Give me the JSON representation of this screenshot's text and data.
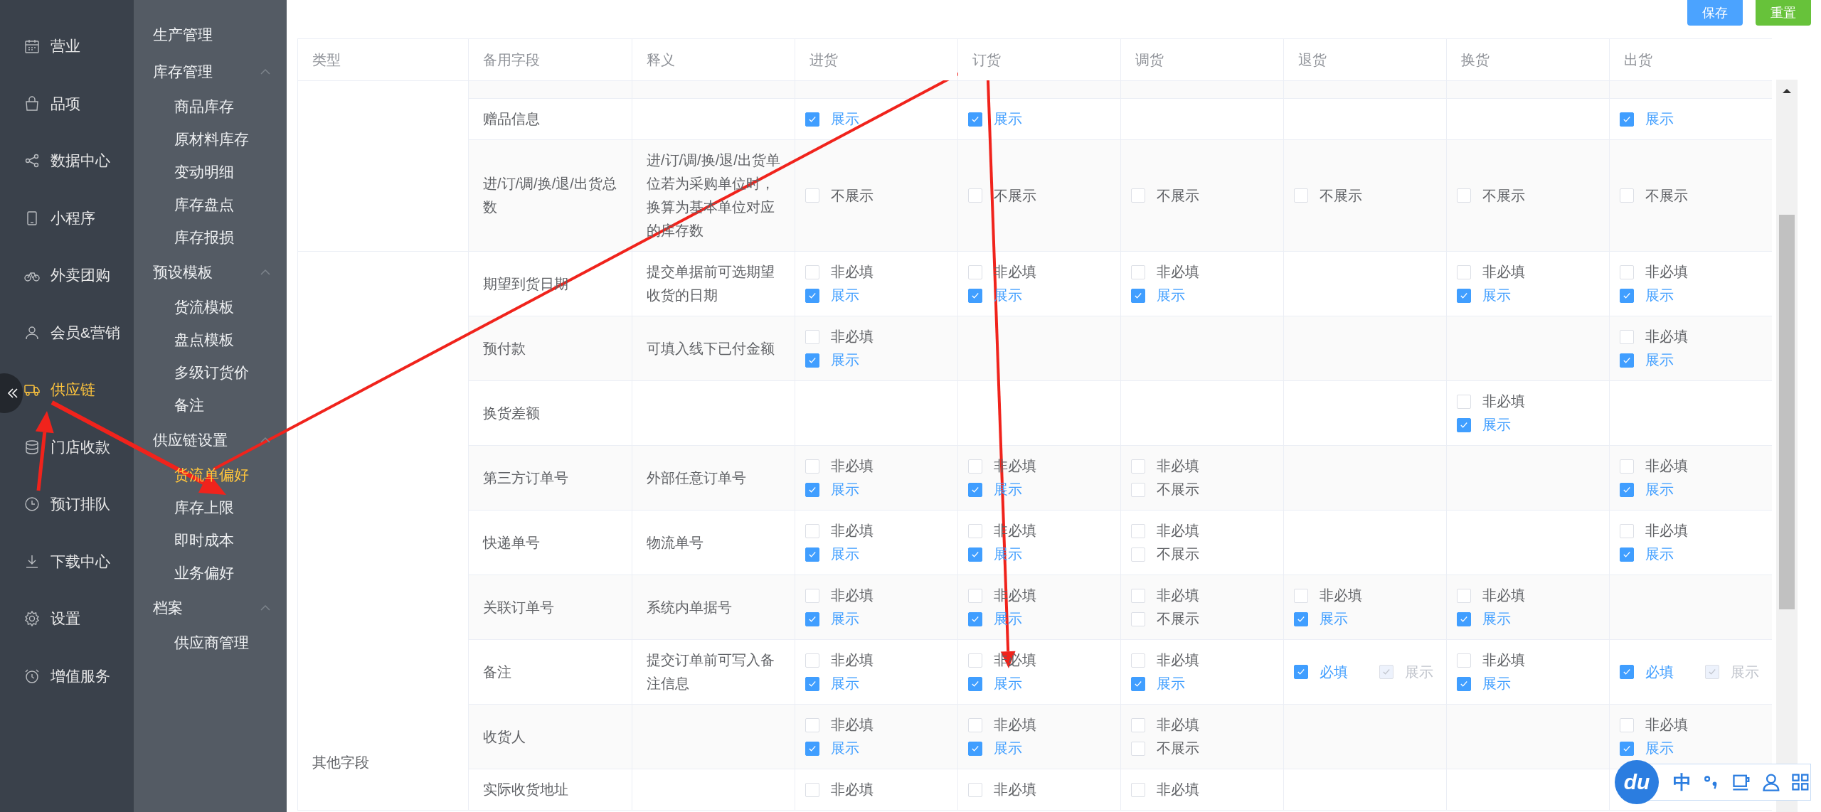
{
  "nav": [
    {
      "label": "营业",
      "selected": false
    },
    {
      "label": "品项",
      "selected": false
    },
    {
      "label": "数据中心",
      "selected": false
    },
    {
      "label": "小程序",
      "selected": false
    },
    {
      "label": "外卖团购",
      "selected": false
    },
    {
      "label": "会员&营销",
      "selected": false
    },
    {
      "label": "供应链",
      "selected": true
    },
    {
      "label": "门店收款",
      "selected": false
    },
    {
      "label": "预订排队",
      "selected": false
    },
    {
      "label": "下载中心",
      "selected": false
    },
    {
      "label": "设置",
      "selected": false
    },
    {
      "label": "增值服务",
      "selected": false
    }
  ],
  "subnav": [
    {
      "kind": "single",
      "label": "生产管理"
    },
    {
      "kind": "group",
      "label": "库存管理",
      "expanded": true,
      "children": [
        {
          "label": "商品库存",
          "selected": false
        },
        {
          "label": "原材料库存",
          "selected": false
        },
        {
          "label": "变动明细",
          "selected": false
        },
        {
          "label": "库存盘点",
          "selected": false
        },
        {
          "label": "库存报损",
          "selected": false
        }
      ]
    },
    {
      "kind": "group",
      "label": "预设模板",
      "expanded": true,
      "children": [
        {
          "label": "货流模板",
          "selected": false
        },
        {
          "label": "盘点模板",
          "selected": false
        },
        {
          "label": "多级订货价",
          "selected": false
        },
        {
          "label": "备注",
          "selected": false
        }
      ]
    },
    {
      "kind": "group",
      "label": "供应链设置",
      "expanded": true,
      "children": [
        {
          "label": "货流单偏好",
          "selected": true
        },
        {
          "label": "库存上限",
          "selected": false
        },
        {
          "label": "即时成本",
          "selected": false
        },
        {
          "label": "业务偏好",
          "selected": false
        }
      ]
    },
    {
      "kind": "group",
      "label": "档案",
      "expanded": true,
      "children": [
        {
          "label": "供应商管理",
          "selected": false
        }
      ]
    }
  ],
  "buttons": [
    {
      "label": "保存",
      "kind": "primary"
    },
    {
      "label": "重置",
      "kind": "success"
    }
  ],
  "table": {
    "columns": [
      "类型",
      "备用字段",
      "释义",
      "进货",
      "订货",
      "调货",
      "退货",
      "换货",
      "出货"
    ],
    "groups": [
      {
        "rows": [
          {
            "field": "赠品信息",
            "cells": [
              {
                "kind": "stack",
                "options": [
                  {
                    "label": "展示",
                    "checked": true,
                    "disabled": false
                  }
                ]
              },
              {
                "kind": "stack",
                "options": [
                  {
                    "label": "展示",
                    "checked": true,
                    "disabled": false
                  }
                ]
              },
              null,
              null,
              null,
              {
                "kind": "stack",
                "options": [
                  {
                    "label": "展示",
                    "checked": true,
                    "disabled": false
                  }
                ]
              }
            ]
          },
          {
            "field": "进/订/调/换/退/出货总数",
            "note": "进/订/调/换/退/出货单位若为采购单位时，换算为基本单位对应的库存数",
            "cells": [
              {
                "kind": "stack",
                "options": [
                  {
                    "label": "不展示",
                    "checked": false,
                    "disabled": false
                  }
                ]
              },
              {
                "kind": "stack",
                "options": [
                  {
                    "label": "不展示",
                    "checked": false,
                    "disabled": false
                  }
                ]
              },
              {
                "kind": "stack",
                "options": [
                  {
                    "label": "不展示",
                    "checked": false,
                    "disabled": false
                  }
                ]
              },
              {
                "kind": "stack",
                "options": [
                  {
                    "label": "不展示",
                    "checked": false,
                    "disabled": false
                  }
                ]
              },
              {
                "kind": "stack",
                "options": [
                  {
                    "label": "不展示",
                    "checked": false,
                    "disabled": false
                  }
                ]
              },
              {
                "kind": "stack",
                "options": [
                  {
                    "label": "不展示",
                    "checked": false,
                    "disabled": false
                  }
                ]
              }
            ]
          }
        ]
      },
      {
        "label": "其他字段",
        "rows": [
          {
            "field": "期望到货日期",
            "note": "提交单据前可选期望收货的日期",
            "cells": [
              {
                "kind": "stack",
                "options": [
                  {
                    "label": "非必填",
                    "checked": false,
                    "disabled": false
                  },
                  {
                    "label": "展示",
                    "checked": true,
                    "disabled": false
                  }
                ]
              },
              {
                "kind": "stack",
                "options": [
                  {
                    "label": "非必填",
                    "checked": false,
                    "disabled": false
                  },
                  {
                    "label": "展示",
                    "checked": true,
                    "disabled": false
                  }
                ]
              },
              {
                "kind": "stack",
                "options": [
                  {
                    "label": "非必填",
                    "checked": false,
                    "disabled": false
                  },
                  {
                    "label": "展示",
                    "checked": true,
                    "disabled": false
                  }
                ]
              },
              null,
              {
                "kind": "stack",
                "options": [
                  {
                    "label": "非必填",
                    "checked": false,
                    "disabled": false
                  },
                  {
                    "label": "展示",
                    "checked": true,
                    "disabled": false
                  }
                ]
              },
              {
                "kind": "stack",
                "options": [
                  {
                    "label": "非必填",
                    "checked": false,
                    "disabled": false
                  },
                  {
                    "label": "展示",
                    "checked": true,
                    "disabled": false
                  }
                ]
              }
            ]
          },
          {
            "field": "预付款",
            "note": "可填入线下已付金额",
            "cells": [
              {
                "kind": "stack",
                "options": [
                  {
                    "label": "非必填",
                    "checked": false,
                    "disabled": false
                  },
                  {
                    "label": "展示",
                    "checked": true,
                    "disabled": false
                  }
                ]
              },
              null,
              null,
              null,
              null,
              {
                "kind": "stack",
                "options": [
                  {
                    "label": "非必填",
                    "checked": false,
                    "disabled": false
                  },
                  {
                    "label": "展示",
                    "checked": true,
                    "disabled": false
                  }
                ]
              }
            ]
          },
          {
            "field": "换货差额",
            "cells": [
              null,
              null,
              null,
              null,
              {
                "kind": "stack",
                "options": [
                  {
                    "label": "非必填",
                    "checked": false,
                    "disabled": false
                  },
                  {
                    "label": "展示",
                    "checked": true,
                    "disabled": false
                  }
                ]
              },
              null
            ]
          },
          {
            "field": "第三方订单号",
            "note": "外部任意订单号",
            "cells": [
              {
                "kind": "stack",
                "options": [
                  {
                    "label": "非必填",
                    "checked": false,
                    "disabled": false
                  },
                  {
                    "label": "展示",
                    "checked": true,
                    "disabled": false
                  }
                ]
              },
              {
                "kind": "stack",
                "options": [
                  {
                    "label": "非必填",
                    "checked": false,
                    "disabled": false
                  },
                  {
                    "label": "展示",
                    "checked": true,
                    "disabled": false
                  }
                ]
              },
              {
                "kind": "stack",
                "options": [
                  {
                    "label": "非必填",
                    "checked": false,
                    "disabled": false
                  },
                  {
                    "label": "不展示",
                    "checked": false,
                    "disabled": false
                  }
                ]
              },
              null,
              null,
              {
                "kind": "stack",
                "options": [
                  {
                    "label": "非必填",
                    "checked": false,
                    "disabled": false
                  },
                  {
                    "label": "展示",
                    "checked": true,
                    "disabled": false
                  }
                ]
              }
            ]
          },
          {
            "field": "快递单号",
            "note": "物流单号",
            "cells": [
              {
                "kind": "stack",
                "options": [
                  {
                    "label": "非必填",
                    "checked": false,
                    "disabled": false
                  },
                  {
                    "label": "展示",
                    "checked": true,
                    "disabled": false
                  }
                ]
              },
              {
                "kind": "stack",
                "options": [
                  {
                    "label": "非必填",
                    "checked": false,
                    "disabled": false
                  },
                  {
                    "label": "展示",
                    "checked": true,
                    "disabled": false
                  }
                ]
              },
              {
                "kind": "stack",
                "options": [
                  {
                    "label": "非必填",
                    "checked": false,
                    "disabled": false
                  },
                  {
                    "label": "不展示",
                    "checked": false,
                    "disabled": false
                  }
                ]
              },
              null,
              null,
              {
                "kind": "stack",
                "options": [
                  {
                    "label": "非必填",
                    "checked": false,
                    "disabled": false
                  },
                  {
                    "label": "展示",
                    "checked": true,
                    "disabled": false
                  }
                ]
              }
            ]
          },
          {
            "field": "关联订单号",
            "note": "系统内单据号",
            "cells": [
              {
                "kind": "stack",
                "options": [
                  {
                    "label": "非必填",
                    "checked": false,
                    "disabled": false
                  },
                  {
                    "label": "展示",
                    "checked": true,
                    "disabled": false
                  }
                ]
              },
              {
                "kind": "stack",
                "options": [
                  {
                    "label": "非必填",
                    "checked": false,
                    "disabled": false
                  },
                  {
                    "label": "展示",
                    "checked": true,
                    "disabled": false
                  }
                ]
              },
              {
                "kind": "stack",
                "options": [
                  {
                    "label": "非必填",
                    "checked": false,
                    "disabled": false
                  },
                  {
                    "label": "不展示",
                    "checked": false,
                    "disabled": false
                  }
                ]
              },
              {
                "kind": "stack",
                "options": [
                  {
                    "label": "非必填",
                    "checked": false,
                    "disabled": false
                  },
                  {
                    "label": "展示",
                    "checked": true,
                    "disabled": false
                  }
                ]
              },
              {
                "kind": "stack",
                "options": [
                  {
                    "label": "非必填",
                    "checked": false,
                    "disabled": false
                  },
                  {
                    "label": "展示",
                    "checked": true,
                    "disabled": false
                  }
                ]
              },
              null
            ]
          },
          {
            "field": "备注",
            "note": "提交订单前可写入备注信息",
            "cells": [
              {
                "kind": "stack",
                "options": [
                  {
                    "label": "非必填",
                    "checked": false,
                    "disabled": false
                  },
                  {
                    "label": "展示",
                    "checked": true,
                    "disabled": false
                  }
                ]
              },
              {
                "kind": "stack",
                "options": [
                  {
                    "label": "非必填",
                    "checked": false,
                    "disabled": false
                  },
                  {
                    "label": "展示",
                    "checked": true,
                    "disabled": false
                  }
                ]
              },
              {
                "kind": "stack",
                "options": [
                  {
                    "label": "非必填",
                    "checked": false,
                    "disabled": false
                  },
                  {
                    "label": "展示",
                    "checked": true,
                    "disabled": false
                  }
                ]
              },
              {
                "kind": "inline",
                "options": [
                  {
                    "label": "必填",
                    "checked": true,
                    "disabled": false
                  },
                  {
                    "label": "展示",
                    "checked": true,
                    "disabled": true
                  }
                ]
              },
              {
                "kind": "stack",
                "options": [
                  {
                    "label": "非必填",
                    "checked": false,
                    "disabled": false
                  },
                  {
                    "label": "展示",
                    "checked": true,
                    "disabled": false
                  }
                ]
              },
              {
                "kind": "inline",
                "options": [
                  {
                    "label": "必填",
                    "checked": true,
                    "disabled": false
                  },
                  {
                    "label": "展示",
                    "checked": true,
                    "disabled": true
                  }
                ]
              }
            ]
          },
          {
            "field": "收货人",
            "cells": [
              {
                "kind": "stack",
                "options": [
                  {
                    "label": "非必填",
                    "checked": false,
                    "disabled": false
                  },
                  {
                    "label": "展示",
                    "checked": true,
                    "disabled": false
                  }
                ]
              },
              {
                "kind": "stack",
                "options": [
                  {
                    "label": "非必填",
                    "checked": false,
                    "disabled": false
                  },
                  {
                    "label": "展示",
                    "checked": true,
                    "disabled": false
                  }
                ]
              },
              {
                "kind": "stack",
                "options": [
                  {
                    "label": "非必填",
                    "checked": false,
                    "disabled": false
                  },
                  {
                    "label": "不展示",
                    "checked": false,
                    "disabled": false
                  }
                ]
              },
              null,
              null,
              {
                "kind": "stack",
                "options": [
                  {
                    "label": "非必填",
                    "checked": false,
                    "disabled": false
                  },
                  {
                    "label": "展示",
                    "checked": true,
                    "disabled": false
                  }
                ]
              }
            ]
          },
          {
            "field": "实际收货地址",
            "cells": [
              {
                "kind": "stack",
                "options": [
                  {
                    "label": "非必填",
                    "checked": false,
                    "disabled": false
                  }
                ]
              },
              {
                "kind": "stack",
                "options": [
                  {
                    "label": "非必填",
                    "checked": false,
                    "disabled": false
                  }
                ]
              },
              {
                "kind": "stack",
                "options": [
                  {
                    "label": "非必填",
                    "checked": false,
                    "disabled": false
                  }
                ]
              },
              null,
              null,
              null
            ]
          }
        ]
      }
    ]
  },
  "ime_toolbar": {
    "logo": "du",
    "mode": "中"
  }
}
